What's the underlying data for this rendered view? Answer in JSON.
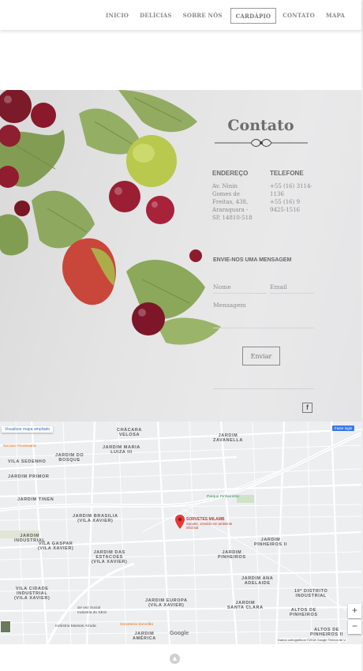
{
  "nav": {
    "items": [
      {
        "label": "INICIO",
        "active": false
      },
      {
        "label": "DELÍCIAS",
        "active": false
      },
      {
        "label": "SOBRE NÓS",
        "active": false
      },
      {
        "label": "CARDÁPIO",
        "active": true
      },
      {
        "label": "CONTATO",
        "active": false
      },
      {
        "label": "MAPA",
        "active": false
      }
    ]
  },
  "contact": {
    "title": "Contato",
    "address_heading": "ENDEREÇO",
    "address_lines": [
      "Av. Ninin",
      "Gomes de",
      "Freitas, 438,",
      "Araraquara -",
      "SP, 14810-518"
    ],
    "phone_heading": "TELEFONE",
    "phone_lines": [
      "+55 (16) 3114-",
      "1136",
      "+55 (16) 9",
      "9425-1516"
    ],
    "message_heading": "ENVIE-NOS UMA MENSAGEM",
    "name_placeholder": "Nome",
    "email_placeholder": "Email",
    "message_placeholder": "Mensagem",
    "send_label": "Enviar",
    "social_icon": "facebook-icon",
    "social_glyph": "f"
  },
  "map": {
    "larger_map_link": "Visualizar mapa ampliado",
    "login_button": "Fazer login",
    "zoom_in": "+",
    "zoom_out": "−",
    "pin_title": "SORVETES MILAMB",
    "pin_subtitle": "Sorvete, vendido em ambiente informal",
    "places": [
      "Nectare Picolesaria",
      "Parque Pinheirinho",
      "Se vez Social",
      "Indústria do SESI",
      "Indústria Massas Arruda",
      "Sorveteria Sorvelão"
    ],
    "neighborhoods": [
      {
        "name": "CHÁCARA\nVELOSA"
      },
      {
        "name": "JARDIM\nZAVANELLA"
      },
      {
        "name": "JARDIM DO\nBOSQUE"
      },
      {
        "name": "JARDIM MARIA\nLUIZA III"
      },
      {
        "name": "VILA SEDENHO"
      },
      {
        "name": "JARDIM PRIMOR"
      },
      {
        "name": "JARDIM TINEN"
      },
      {
        "name": "JARDIM BRASILIA\n(VILA XAVIER)"
      },
      {
        "name": "JARDIM\nPINHEIROS II"
      },
      {
        "name": "JARDIM\nINDUSTRIAL"
      },
      {
        "name": "VILA GASPAR\n(VILA XAVIER)"
      },
      {
        "name": "JARDIM DAS\nESTACOES\n(VILA XAVIER)"
      },
      {
        "name": "JARDIM\nPINHEIROS"
      },
      {
        "name": "JARDIM ANA\nADELAIDE"
      },
      {
        "name": "VILA CIDADE\nINDUSTRIAL\n(VILA XAVIER)"
      },
      {
        "name": "JARDIM EUROPA\n(VILA XAVIER)"
      },
      {
        "name": "JARDIM\nSANTA CLARA"
      },
      {
        "name": "10º DISTRITO\nINDUSTRIAL"
      },
      {
        "name": "ALTOS DE\nPINHEIROS"
      },
      {
        "name": "JARDIM\nAMÉRICA"
      },
      {
        "name": "ALTOS DE\nPINHEIROS II"
      }
    ],
    "attribution": "Dados cartográficos ©2018 Google    Termos de U",
    "google_logo": "Google"
  },
  "back_to_top_glyph": "▲"
}
